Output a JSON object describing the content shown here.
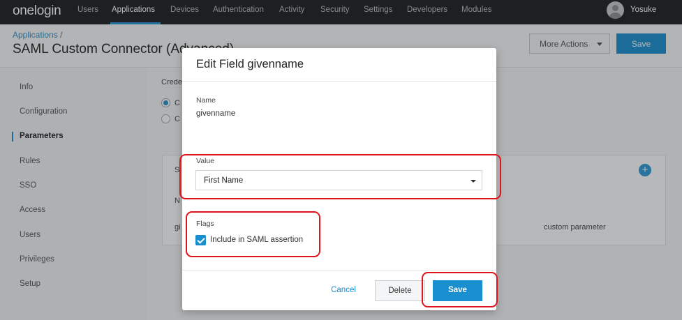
{
  "topnav": {
    "brand": "onelogin",
    "items": [
      "Users",
      "Applications",
      "Devices",
      "Authentication",
      "Activity",
      "Security",
      "Settings",
      "Developers",
      "Modules"
    ],
    "active": "Applications",
    "user": "Yosuke"
  },
  "header": {
    "breadcrumb": "Applications",
    "breadcrumb_sep": "/",
    "title": "SAML Custom Connector (Advanced)",
    "more_actions_label": "More Actions",
    "save_label": "Save"
  },
  "sidebar": {
    "items": [
      "Info",
      "Configuration",
      "Parameters",
      "Rules",
      "SSO",
      "Access",
      "Users",
      "Privileges",
      "Setup"
    ],
    "active": "Parameters"
  },
  "background": {
    "credentials_label": "Crede",
    "radio1": "C",
    "radio2": "C",
    "row_header": "S",
    "col_header": "N",
    "row_value": "gi",
    "row_type": "custom parameter"
  },
  "modal": {
    "title": "Edit Field givenname",
    "name_label": "Name",
    "name_value": "givenname",
    "value_label": "Value",
    "value_selected": "First Name",
    "flags_label": "Flags",
    "flag_include_label": "Include in SAML assertion",
    "flag_include_checked": true,
    "cancel_label": "Cancel",
    "delete_label": "Delete",
    "save_label": "Save"
  },
  "colors": {
    "accent": "#1a8fd0",
    "nav_bg": "#1c1f21",
    "highlight": "#e0121a"
  }
}
